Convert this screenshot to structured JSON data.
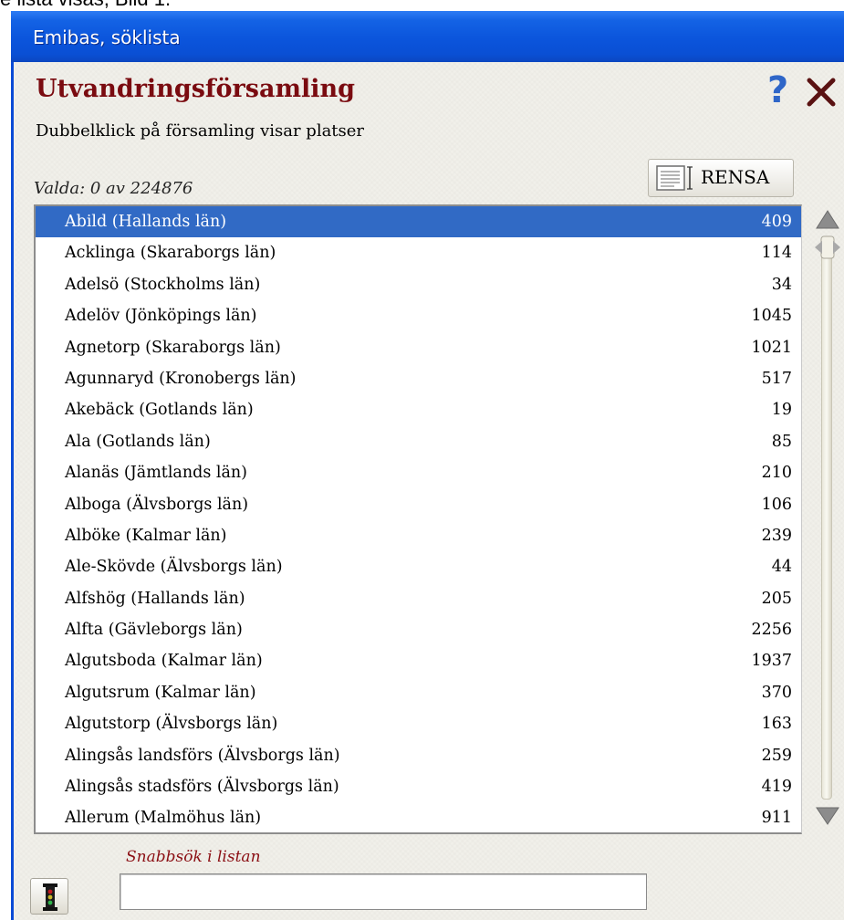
{
  "caption": "e lista visas, Bild 1.",
  "window": {
    "title": "Emibas, söklista"
  },
  "header": {
    "title": "Utvandringsförsamling",
    "subtitle": "Dubbelklick på församling visar platser",
    "help_icon": "?",
    "close_icon": "close-icon"
  },
  "selection": {
    "label": "Valda: 0 av 224876"
  },
  "toolbar": {
    "rensa_label": "RENSA",
    "rensa_icon": "list-document-icon"
  },
  "list": {
    "selected_index": 0,
    "rows": [
      {
        "name": "Abild (Hallands län)",
        "count": "409"
      },
      {
        "name": "Acklinga (Skaraborgs län)",
        "count": "114"
      },
      {
        "name": "Adelsö (Stockholms län)",
        "count": "34"
      },
      {
        "name": "Adelöv (Jönköpings län)",
        "count": "1045"
      },
      {
        "name": "Agnetorp (Skaraborgs län)",
        "count": "1021"
      },
      {
        "name": "Agunnaryd (Kronobergs län)",
        "count": "517"
      },
      {
        "name": "Akebäck (Gotlands län)",
        "count": "19"
      },
      {
        "name": "Ala (Gotlands län)",
        "count": "85"
      },
      {
        "name": "Alanäs (Jämtlands län)",
        "count": "210"
      },
      {
        "name": "Alboga (Älvsborgs län)",
        "count": "106"
      },
      {
        "name": "Alböke (Kalmar län)",
        "count": "239"
      },
      {
        "name": "Ale-Skövde (Älvsborgs län)",
        "count": "44"
      },
      {
        "name": "Alfshög (Hallands län)",
        "count": "205"
      },
      {
        "name": "Alfta (Gävleborgs län)",
        "count": "2256"
      },
      {
        "name": "Algutsboda (Kalmar län)",
        "count": "1937"
      },
      {
        "name": "Algutsrum (Kalmar län)",
        "count": "370"
      },
      {
        "name": "Algutstorp (Älvsborgs län)",
        "count": "163"
      },
      {
        "name": "Alingsås landsförs (Älvsborgs län)",
        "count": "259"
      },
      {
        "name": "Alingsås stadsförs (Älvsborgs län)",
        "count": "419"
      },
      {
        "name": "Allerum (Malmöhus län)",
        "count": "911"
      }
    ]
  },
  "quicksearch": {
    "label": "Snabbsök i listan",
    "value": "",
    "button_icon": "traffic-light-icon"
  },
  "colors": {
    "titlebar": "#0b55dc",
    "heading": "#7a0b10",
    "selection": "#316ac5",
    "help": "#2f66c8"
  }
}
